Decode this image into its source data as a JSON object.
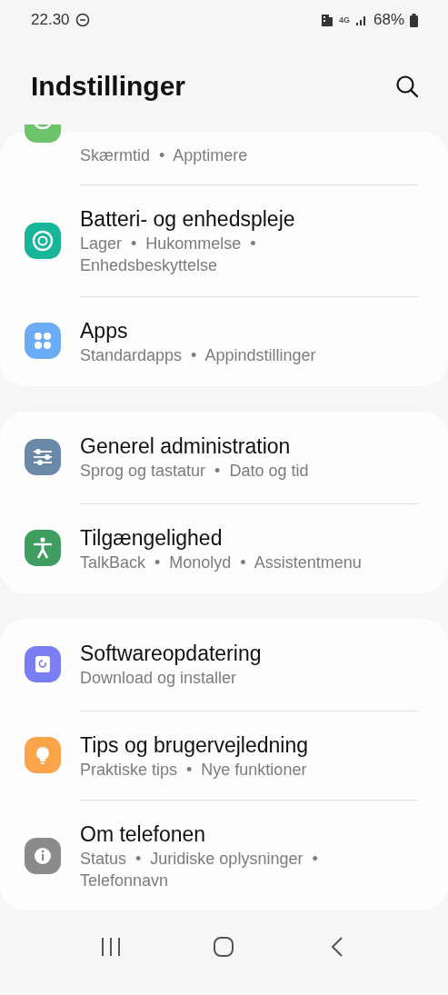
{
  "status_bar": {
    "time": "22.30",
    "network": "4G",
    "battery": "68%"
  },
  "header": {
    "title": "Indstillinger"
  },
  "groups": [
    {
      "items": [
        {
          "kind": "partial",
          "color": "#6cc36a",
          "subtitle": "Skærmtid  •  Apptimere"
        },
        {
          "kind": "full",
          "color": "#17b59a",
          "title": "Batteri- og enhedspleje",
          "subtitle": "Lager  •  Hukommelse  •  Enhedsbeskyttelse"
        },
        {
          "kind": "full",
          "color": "#6aacf5",
          "title": "Apps",
          "subtitle": "Standardapps  •  Appindstillinger"
        }
      ]
    },
    {
      "items": [
        {
          "kind": "full",
          "color": "#6a89a6",
          "title": "Generel administration",
          "subtitle": "Sprog og tastatur  •  Dato og tid"
        },
        {
          "kind": "full",
          "color": "#3f9e5f",
          "title": "Tilgængelighed",
          "subtitle": "TalkBack  •  Monolyd  •  Assistentmenu"
        }
      ]
    },
    {
      "items": [
        {
          "kind": "full",
          "color": "#7a7ef5",
          "title": "Softwareopdatering",
          "subtitle": "Download og installer"
        },
        {
          "kind": "full",
          "color": "#fba44a",
          "title": "Tips og brugervejledning",
          "subtitle": "Praktiske tips  •  Nye funktioner"
        },
        {
          "kind": "full",
          "color": "#8a8a8a",
          "title": "Om telefonen",
          "subtitle": "Status  •  Juridiske oplysninger  •  Telefonnavn"
        }
      ]
    }
  ]
}
